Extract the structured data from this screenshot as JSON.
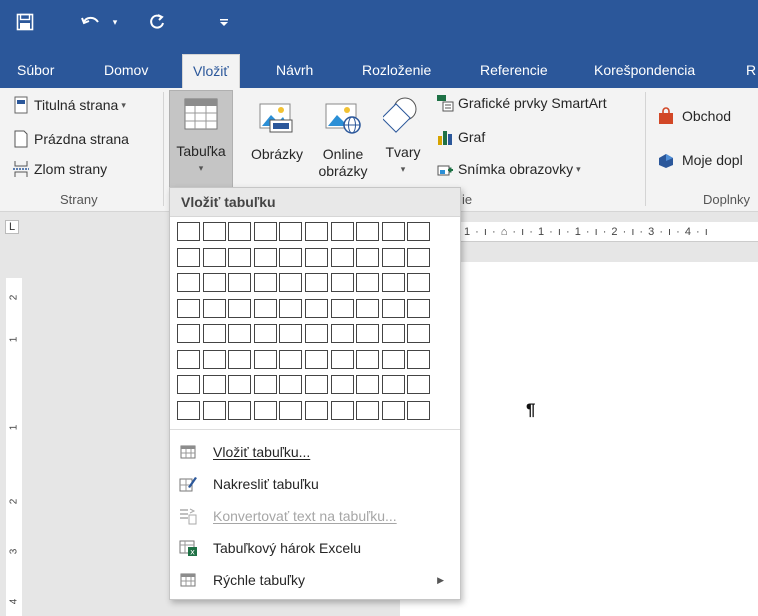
{
  "tabs": [
    "Súbor",
    "Domov",
    "Vložiť",
    "Návrh",
    "Rozloženie",
    "Referencie",
    "Korešpondencia",
    "R"
  ],
  "active_tab": "Vložiť",
  "ribbon": {
    "strany": {
      "items": [
        "Titulná strana",
        "Prázdna strana",
        "Zlom strany"
      ],
      "label": "Strany"
    },
    "tabulka_label": "Tabuľka",
    "obrazky_label": "Obrázky",
    "online_label_1": "Online",
    "online_label_2": "obrázky",
    "tvary_label": "Tvary",
    "smartart_label": "Grafické prvky SmartArt",
    "graf_label": "Graf",
    "snimka_label": "Snímka obrazovky",
    "ilustracie_label_fragment": "ie",
    "obchod_label": "Obchod",
    "moje_label": "Moje dopl",
    "doplnky_label": "Doplnky"
  },
  "ruler": {
    "tab_selector": "L",
    "top_marks": "1 · ı · ⌂ · ı · 1 · ı · 1 · ı · 2 · ı · 3 · ı · 4 · ı",
    "left_marks": [
      "2",
      "1",
      "1",
      "2",
      "3",
      "4"
    ]
  },
  "dropdown": {
    "header": "Vložiť tabuľku",
    "grid": {
      "cols": 10,
      "rows": 8
    },
    "items": [
      {
        "label": "Vložiť tabuľku...",
        "icon": "insert-table-icon",
        "disabled": false
      },
      {
        "label": "Nakresliť tabuľku",
        "icon": "draw-table-icon",
        "disabled": false
      },
      {
        "label": "Konvertovať text na tabuľku...",
        "icon": "convert-text-icon",
        "disabled": true
      },
      {
        "label": "Tabuľkový hárok Excelu",
        "icon": "excel-sheet-icon",
        "disabled": false
      },
      {
        "label": "Rýchle tabuľky",
        "icon": "quick-tables-icon",
        "disabled": false,
        "submenu": true
      }
    ]
  },
  "colors": {
    "brand_blue": "#2b579a",
    "ribbon_bg": "#f3f3f3",
    "excel_green": "#1e7145",
    "store_orange": "#d24726"
  }
}
